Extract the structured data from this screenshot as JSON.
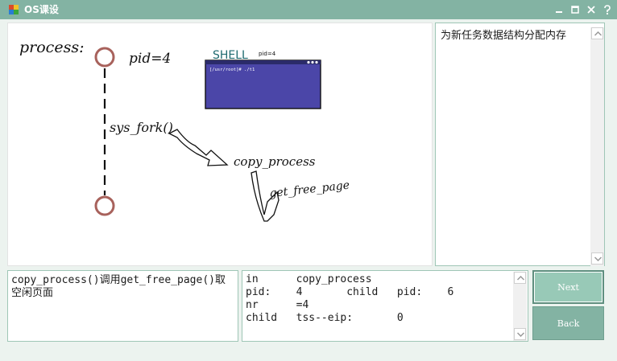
{
  "window": {
    "title": "OS课设"
  },
  "canvas": {
    "process_label": "process:",
    "pid_label": "pid=4",
    "syscall_label": "sys_fork()",
    "copy_label": "copy_process",
    "getpage_label": "get_free_page",
    "shell": {
      "title": "SHELL",
      "pid": "pid=4",
      "prompt": "[/usr/root]# ./t1"
    }
  },
  "description": {
    "text": "为新任务数据结构分配内存"
  },
  "step": {
    "text": "copy_process()调用get_free_page()取空闲页面"
  },
  "info": {
    "lines": [
      "in      copy_process",
      "pid:    4       child   pid:    6",
      "nr      =4",
      "child   tss--eip:       0"
    ]
  },
  "buttons": {
    "next": "Next",
    "back": "Back"
  },
  "icons": {
    "minimize": "minimize-icon",
    "maximize": "maximize-icon",
    "close": "close-icon",
    "help": "help-icon",
    "app": "app-icon"
  },
  "colors": {
    "titlebar": "#83b3a3",
    "button": "#83b3a3",
    "shell_bg": "#4b46a8",
    "process_node": "#a8625c"
  }
}
